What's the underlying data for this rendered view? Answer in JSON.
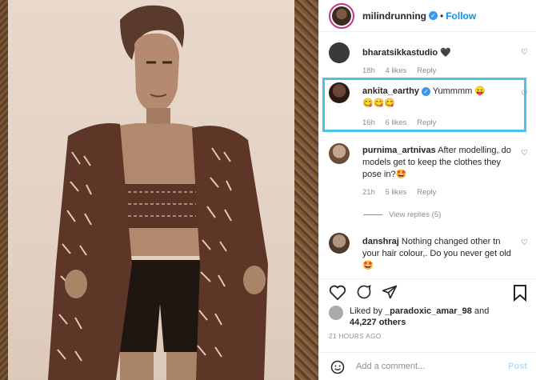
{
  "post": {
    "username": "milindrunning",
    "follow_label": "Follow",
    "separator": "•"
  },
  "comments": [
    {
      "user": "bharatsikkastudio",
      "text": "🖤",
      "time": "18h",
      "likes": "4 likes",
      "reply": "Reply",
      "verified": false
    },
    {
      "user": "ankita_earthy",
      "text": "Yummmm 😛\n😋😋😋",
      "time": "16h",
      "likes": "6 likes",
      "reply": "Reply",
      "verified": true
    },
    {
      "user": "purnima_artnivas",
      "text": "After modelling, do models get to keep the clothes they pose in?🤩",
      "time": "21h",
      "likes": "5 likes",
      "reply": "Reply",
      "verified": false
    },
    {
      "user": "danshraj",
      "text": "Nothing changed other tn your hair colour,. Do you never get old 🤩",
      "verified": false
    }
  ],
  "view_replies": "View replies (5)",
  "likes": {
    "prefix": "Liked by",
    "user": "_paradoxic_amar_98",
    "and": "and",
    "count": "44,227 others"
  },
  "timestamp": "21 HOURS AGO",
  "add_comment": {
    "placeholder": "Add a comment...",
    "post_label": "Post"
  },
  "icons": {
    "heart": "heart-icon",
    "comment": "comment-icon",
    "share": "share-icon",
    "save": "bookmark-icon",
    "emoji": "smiley-icon",
    "more": "more-icon"
  },
  "colors": {
    "accent": "#0095f6",
    "highlight": "#4ec1e6",
    "verified": "#3897f0",
    "muted": "#8e8e8e"
  }
}
